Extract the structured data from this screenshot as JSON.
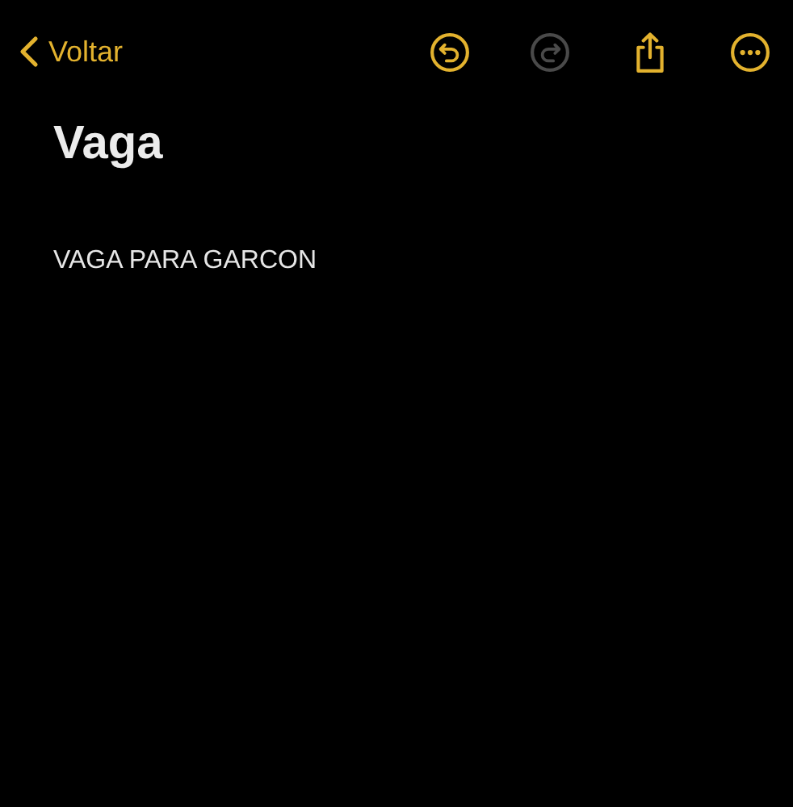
{
  "nav_bar": {
    "back_label": "Voltar",
    "actions": [
      {
        "kind": "undo",
        "disabled": false
      },
      {
        "kind": "redo",
        "disabled": true
      },
      {
        "kind": "share",
        "disabled": false
      },
      {
        "kind": "more",
        "disabled": false
      }
    ]
  },
  "note": {
    "title": "Vaga",
    "body": "VAGA PARA GARCON"
  }
}
